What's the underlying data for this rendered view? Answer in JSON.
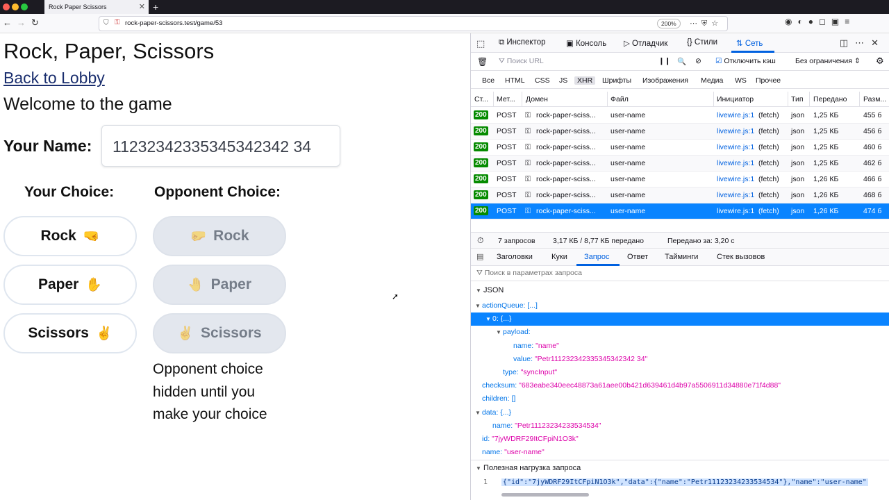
{
  "browser": {
    "tab_title": "Rock Paper Scissors",
    "url": "rock-paper-scissors.test/game/53",
    "zoom": "200%"
  },
  "page": {
    "title": "Rock, Paper, Scissors",
    "back_link": "Back to Lobby",
    "welcome": "Welcome to the game",
    "name_label": "Your Name:",
    "name_value": "11232342335345342342 34",
    "your_choice_title": "Your Choice:",
    "opponent_choice_title": "Opponent Choice:",
    "your_choices": [
      {
        "label": "Rock",
        "emoji": "🤜"
      },
      {
        "label": "Paper",
        "emoji": "✋"
      },
      {
        "label": "Scissors",
        "emoji": "✌️"
      }
    ],
    "opponent_choices": [
      {
        "label": "Rock",
        "emoji": "🤛"
      },
      {
        "label": "Paper",
        "emoji": "🤚"
      },
      {
        "label": "Scissors",
        "emoji": "✌️"
      }
    ],
    "opponent_hint": "Opponent choice hidden until you make your choice"
  },
  "devtools": {
    "tabs": [
      "Инспектор",
      "Консоль",
      "Отладчик",
      "Стили",
      "Сеть"
    ],
    "active_tab": "Сеть",
    "filter_placeholder": "Поиск URL",
    "disable_cache": "Отключить кэш",
    "throttling": "Без ограничения",
    "types": [
      "Все",
      "HTML",
      "CSS",
      "JS",
      "XHR",
      "Шрифты",
      "Изображения",
      "Медиа",
      "WS",
      "Прочее"
    ],
    "selected_type": "XHR",
    "columns": [
      "Ст...",
      "Мет...",
      "Домен",
      "Файл",
      "Инициатор",
      "Тип",
      "Передано",
      "Разм..."
    ],
    "requests": [
      {
        "status": "200",
        "method": "POST",
        "domain": "rock-paper-sciss...",
        "file": "user-name",
        "initiator": "livewire.js:1",
        "initiator_suffix": "(fetch)",
        "type": "json",
        "transferred": "1,25 КБ",
        "size": "455 б"
      },
      {
        "status": "200",
        "method": "POST",
        "domain": "rock-paper-sciss...",
        "file": "user-name",
        "initiator": "livewire.js:1",
        "initiator_suffix": "(fetch)",
        "type": "json",
        "transferred": "1,25 КБ",
        "size": "456 б"
      },
      {
        "status": "200",
        "method": "POST",
        "domain": "rock-paper-sciss...",
        "file": "user-name",
        "initiator": "livewire.js:1",
        "initiator_suffix": "(fetch)",
        "type": "json",
        "transferred": "1,25 КБ",
        "size": "460 б"
      },
      {
        "status": "200",
        "method": "POST",
        "domain": "rock-paper-sciss...",
        "file": "user-name",
        "initiator": "livewire.js:1",
        "initiator_suffix": "(fetch)",
        "type": "json",
        "transferred": "1,25 КБ",
        "size": "462 б"
      },
      {
        "status": "200",
        "method": "POST",
        "domain": "rock-paper-sciss...",
        "file": "user-name",
        "initiator": "livewire.js:1",
        "initiator_suffix": "(fetch)",
        "type": "json",
        "transferred": "1,26 КБ",
        "size": "466 б"
      },
      {
        "status": "200",
        "method": "POST",
        "domain": "rock-paper-sciss...",
        "file": "user-name",
        "initiator": "livewire.js:1",
        "initiator_suffix": "(fetch)",
        "type": "json",
        "transferred": "1,26 КБ",
        "size": "468 б"
      },
      {
        "status": "200",
        "method": "POST",
        "domain": "rock-paper-sciss...",
        "file": "user-name",
        "initiator": "livewire.js:1",
        "initiator_suffix": "(fetch)",
        "type": "json",
        "transferred": "1,26 КБ",
        "size": "474 б",
        "selected": true
      }
    ],
    "summary": {
      "requests": "7 запросов",
      "transferred": "3,17 КБ / 8,77 КБ передано",
      "finished": "Передано за: 3,20 с"
    },
    "panel_tabs": [
      "Заголовки",
      "Куки",
      "Запрос",
      "Ответ",
      "Тайминги",
      "Стек вызовов"
    ],
    "active_panel_tab": "Запрос",
    "param_filter_placeholder": "Поиск в параметрах запроса",
    "json_section": "JSON",
    "tree": [
      {
        "indent": 1,
        "arrow": "▼",
        "key": "actionQueue",
        "value": "[...]",
        "vtype": "k"
      },
      {
        "indent": 2,
        "arrow": "▼",
        "key": "0",
        "value": "{...}",
        "vtype": "k",
        "selected": true
      },
      {
        "indent": 3,
        "arrow": "▼",
        "key": "payload",
        "value": "",
        "vtype": "k"
      },
      {
        "indent": 4,
        "arrow": "",
        "key": "name",
        "value": "\"name\"",
        "vtype": "s"
      },
      {
        "indent": 4,
        "arrow": "",
        "key": "value",
        "value": "\"Petr111232342335345342342 34\"",
        "vtype": "s"
      },
      {
        "indent": 3,
        "arrow": "",
        "key": "type",
        "value": "\"syncInput\"",
        "vtype": "s"
      },
      {
        "indent": 1,
        "arrow": "",
        "key": "checksum",
        "value": "\"683eabe340eec48873a61aee00b421d639461d4b97a5506911d34880e71f4d88\"",
        "vtype": "s"
      },
      {
        "indent": 1,
        "arrow": "",
        "key": "children",
        "value": "[]",
        "vtype": "k"
      },
      {
        "indent": 1,
        "arrow": "▼",
        "key": "data",
        "value": "{...}",
        "vtype": "k"
      },
      {
        "indent": 2,
        "arrow": "",
        "key": "name",
        "value": "\"Petr11123234233534534\"",
        "vtype": "s"
      },
      {
        "indent": 1,
        "arrow": "",
        "key": "id",
        "value": "\"7jyWDRF29ItCFpiN1O3k\"",
        "vtype": "s"
      },
      {
        "indent": 1,
        "arrow": "",
        "key": "name",
        "value": "\"user-name\"",
        "vtype": "s"
      }
    ],
    "payload_section": "Полезная нагрузка запроса",
    "payload_line_number": "1",
    "payload_text": "{\"id\":\"7jyWDRF29ItCFpiN1O3k\",\"data\":{\"name\":\"Petr11123234233534534\"},\"name\":\"user-name\""
  },
  "colors": {
    "accent": "#0061e0",
    "selected_row": "#0a84ff",
    "status_ok": "#058b00",
    "json_key": "#0074e8",
    "json_string": "#dd00a9"
  }
}
